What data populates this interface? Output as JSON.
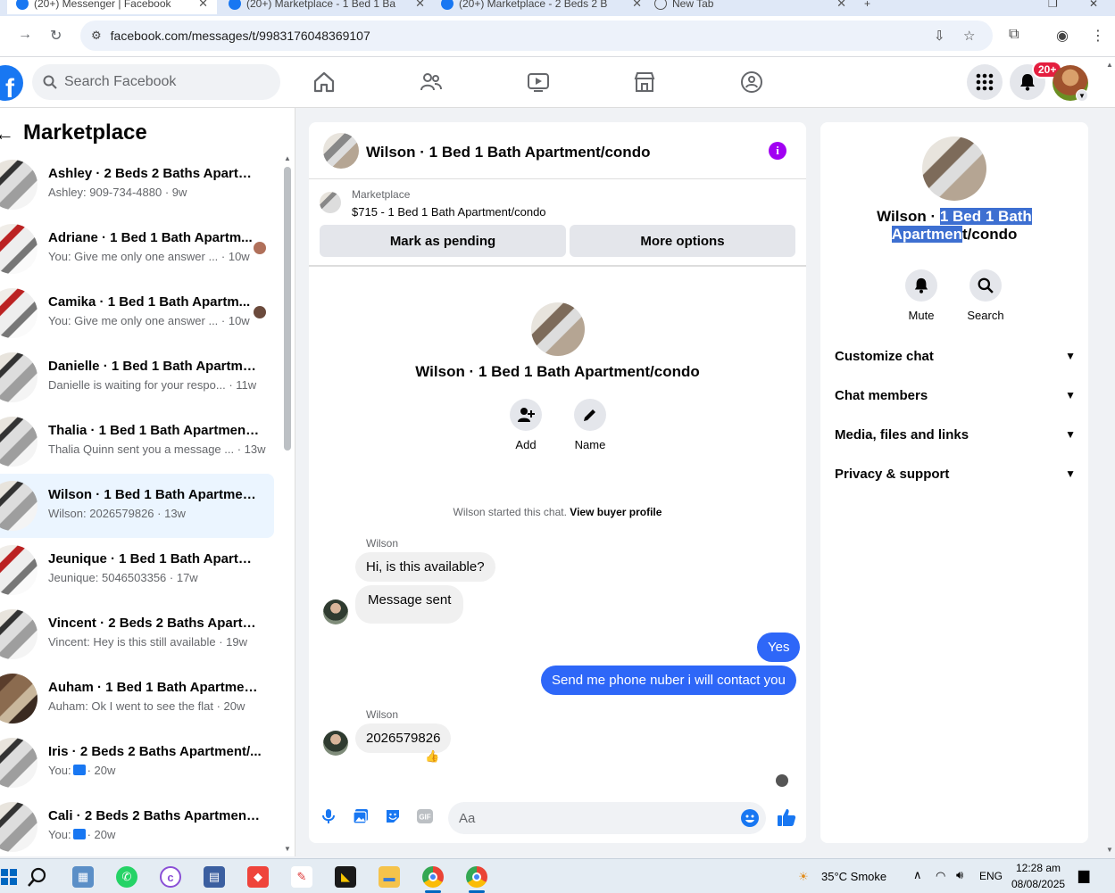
{
  "browser": {
    "tabs": [
      {
        "title": "(20+) Messenger | Facebook",
        "active": true
      },
      {
        "title": "(20+) Marketplace - 1 Bed 1 Ba"
      },
      {
        "title": "(20+) Marketplace - 2 Beds 2 B"
      },
      {
        "title": "New Tab"
      }
    ],
    "url": "facebook.com/messages/t/9983176048369107"
  },
  "header": {
    "logo": "f",
    "search_placeholder": "Search Facebook",
    "notification_badge": "20+"
  },
  "sidebar": {
    "title": "Marketplace",
    "conversations": [
      {
        "name": "Ashley · 2 Beds 2 Baths Apartme...",
        "snippet": "Ashley: 909-734-4880 · 9w"
      },
      {
        "name": "Adriane · 1 Bed 1 Bath Apartm...",
        "snippet": "You: Give me only one answer ... · 10w"
      },
      {
        "name": "Camika · 1 Bed 1 Bath Apartm...",
        "snippet": "You: Give me only one answer ... · 10w"
      },
      {
        "name": "Danielle · 1 Bed 1 Bath Apartmen...",
        "snippet": "Danielle is waiting for your respo... · 11w"
      },
      {
        "name": "Thalia · 1 Bed 1 Bath Apartment/...",
        "snippet": "Thalia Quinn sent you a message ... · 13w"
      },
      {
        "name": "Wilson · 1 Bed 1 Bath Apartment...",
        "snippet": "Wilson: 2026579826 · 13w"
      },
      {
        "name": "Jeunique · 1 Bed 1 Bath Apartme...",
        "snippet": "Jeunique: 5046503356 · 17w"
      },
      {
        "name": "Vincent · 2 Beds 2 Baths Apartm...",
        "snippet": "Vincent: Hey is this still available · 19w"
      },
      {
        "name": "Auham · 1 Bed 1 Bath Apartment...",
        "snippet": "Auham: Ok I went to see the flat · 20w"
      },
      {
        "name": "Iris · 2 Beds 2 Baths Apartment/...",
        "snippet_prefix": "You:",
        "snippet": "· 20w"
      },
      {
        "name": "Cali · 2 Beds 2 Baths Apartment/...",
        "snippet_prefix": "You:",
        "snippet": "· 20w"
      }
    ]
  },
  "chat": {
    "title": "Wilson · 1 Bed 1 Bath Apartment/condo",
    "marketplace_label": "Marketplace",
    "listing": "$715 - 1 Bed 1 Bath Apartment/condo",
    "mark_pending": "Mark as pending",
    "more_options": "More options",
    "intro_title": "Wilson · 1 Bed 1 Bath Apartment/condo",
    "add_label": "Add",
    "name_label": "Name",
    "started_text": "Wilson started this chat.",
    "view_buyer": "View buyer profile",
    "sender1": "Wilson",
    "msg1": "Hi, is this available?",
    "msg2": "Message sent",
    "msg3": "Yes",
    "msg4": "Send me phone nuber i will contact you",
    "sender2": "Wilson",
    "msg5": "2026579826",
    "composer_placeholder": "Aa"
  },
  "info": {
    "title_plain": "Wilson · ",
    "title_highlight1": "1 Bed 1 Bath",
    "title_highlight2": "Apartmen",
    "title_rest": "t/condo",
    "mute": "Mute",
    "search": "Search",
    "sections": [
      "Customize chat",
      "Chat members",
      "Media, files and links",
      "Privacy & support"
    ]
  },
  "taskbar": {
    "weather": "35°C  Smoke",
    "lang": "ENG",
    "time": "12:28 am",
    "date": "08/08/2025"
  },
  "colors": {
    "fb_blue": "#1877f2",
    "bubble_out": "#2e67f8",
    "info_purple": "#a100f2",
    "badge_red": "#e41e3f"
  }
}
